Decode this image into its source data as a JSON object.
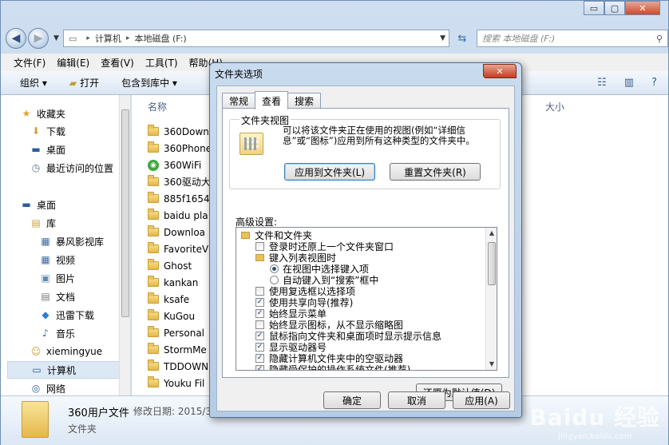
{
  "window": {
    "caption_buttons": {
      "minimize": "▭",
      "maximize": "▢",
      "close": "✕"
    }
  },
  "nav": {
    "back_icon": "back-arrow-icon",
    "forward_icon": "forward-arrow-icon",
    "address": [
      "计算机",
      "本地磁盘 (F:)"
    ],
    "search_placeholder": "搜索 本地磁盘 (F:)"
  },
  "menubar": [
    "文件(F)",
    "编辑(E)",
    "查看(V)",
    "工具(T)",
    "帮助(H)"
  ],
  "toolbar": {
    "organize": "组织 ▾",
    "open": "打开",
    "include": "包含到库中 ▾"
  },
  "sidebar": {
    "items": [
      {
        "label": "收藏夹",
        "icon": "★"
      },
      {
        "label": "下载",
        "icon": "⬇"
      },
      {
        "label": "桌面",
        "icon": "▬"
      },
      {
        "label": "最近访问的位置",
        "icon": "◷"
      },
      {
        "label": "桌面",
        "icon": "▬"
      },
      {
        "label": "库",
        "icon": "▤"
      },
      {
        "label": "暴风影视库",
        "icon": "▦"
      },
      {
        "label": "视频",
        "icon": "▦"
      },
      {
        "label": "图片",
        "icon": "▣"
      },
      {
        "label": "文档",
        "icon": "▤"
      },
      {
        "label": "迅雷下载",
        "icon": "◆"
      },
      {
        "label": "音乐",
        "icon": "♪"
      },
      {
        "label": "xiemingyue",
        "icon": "☺"
      },
      {
        "label": "计算机",
        "icon": "▭"
      },
      {
        "label": "网络",
        "icon": "◎"
      }
    ]
  },
  "filelist": {
    "col_name": "名称",
    "col_size": "大小",
    "files": [
      "360Down",
      "360Phone",
      "360WiFi",
      "360驱动大",
      "885f1654",
      "baidu pla",
      "Downloa",
      "FavoriteV",
      "Ghost",
      "kankan",
      "ksafe",
      "KuGou",
      "Personal",
      "StormMe",
      "TDDOWN",
      "Youku Fil"
    ]
  },
  "details": {
    "name": "360用户文件",
    "meta": "修改日期: 2015/3",
    "type": "文件夹"
  },
  "dialog": {
    "title": "文件夹选项",
    "close": "✕",
    "tabs": [
      "常规",
      "查看",
      "搜索"
    ],
    "group_label": "文件夹视图",
    "group_desc": "可以将该文件夹正在使用的视图(例如“详细信息”或“图标”)应用到所有这种类型的文件夹中。",
    "apply_to_folders": "应用到文件夹(L)",
    "reset_folders": "重置文件夹(R)",
    "advanced_label": "高级设置:",
    "tree": [
      {
        "type": "folder",
        "level": 0,
        "label": "文件和文件夹"
      },
      {
        "type": "check",
        "level": 1,
        "checked": false,
        "label": "登录时还原上一个文件夹窗口"
      },
      {
        "type": "folder",
        "level": 1,
        "label": "键入列表视图时"
      },
      {
        "type": "radio",
        "level": 2,
        "checked": true,
        "label": "在视图中选择键入项"
      },
      {
        "type": "radio",
        "level": 2,
        "checked": false,
        "label": "自动键入到“搜索”框中"
      },
      {
        "type": "check",
        "level": 1,
        "checked": false,
        "label": "使用复选框以选择项"
      },
      {
        "type": "check",
        "level": 1,
        "checked": true,
        "label": "使用共享向导(推荐)"
      },
      {
        "type": "check",
        "level": 1,
        "checked": true,
        "label": "始终显示菜单"
      },
      {
        "type": "check",
        "level": 1,
        "checked": false,
        "label": "始终显示图标，从不显示缩略图"
      },
      {
        "type": "check",
        "level": 1,
        "checked": true,
        "label": "鼠标指向文件夹和桌面项时显示提示信息"
      },
      {
        "type": "check",
        "level": 1,
        "checked": true,
        "label": "显示驱动器号"
      },
      {
        "type": "check",
        "level": 1,
        "checked": true,
        "label": "隐藏计算机文件夹中的空驱动器"
      },
      {
        "type": "check",
        "level": 1,
        "checked": true,
        "label": "隐藏受保护的操作系统文件(推荐)"
      }
    ],
    "restore_defaults": "还原为默认值(D)",
    "ok": "确定",
    "cancel": "取消",
    "apply": "应用(A)"
  },
  "watermark": {
    "text": "Baidu 经验",
    "sub": "jingyan.baidu.com"
  }
}
